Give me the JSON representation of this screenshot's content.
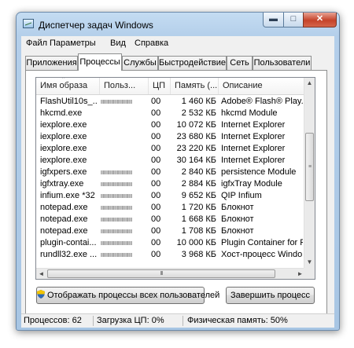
{
  "window": {
    "title": "Диспетчер задач Windows",
    "minimize_glyph": "▬",
    "maximize_glyph": "□",
    "close_glyph": "✕"
  },
  "menu": {
    "items": [
      "Файл",
      "Параметры",
      "Вид",
      "Справка"
    ]
  },
  "tabs": {
    "items": [
      "Приложения",
      "Процессы",
      "Службы",
      "Быстродействие",
      "Сеть",
      "Пользователи"
    ],
    "active": "Процессы"
  },
  "table": {
    "columns": [
      "Имя образа",
      "Польз...",
      "ЦП",
      "Память (...",
      "Описание"
    ],
    "sort_glyph": "^",
    "rows": [
      {
        "name": "FlashUtil10s_...",
        "cpu": "00",
        "mem": "1 460 КБ",
        "desc": "Adobe® Flash® Play..."
      },
      {
        "name": "hkcmd.exe",
        "cpu": "00",
        "mem": "2 532 КБ",
        "desc": "hkcmd Module"
      },
      {
        "name": "iexplore.exe",
        "cpu": "00",
        "mem": "10 072 КБ",
        "desc": "Internet Explorer"
      },
      {
        "name": "iexplore.exe",
        "cpu": "00",
        "mem": "23 680 КБ",
        "desc": "Internet Explorer"
      },
      {
        "name": "iexplore.exe",
        "cpu": "00",
        "mem": "23 220 КБ",
        "desc": "Internet Explorer"
      },
      {
        "name": "iexplore.exe",
        "cpu": "00",
        "mem": "30 164 КБ",
        "desc": "Internet Explorer"
      },
      {
        "name": "igfxpers.exe",
        "cpu": "00",
        "mem": "2 840 КБ",
        "desc": "persistence Module"
      },
      {
        "name": "igfxtray.exe",
        "cpu": "00",
        "mem": "2 884 КБ",
        "desc": "igfxTray Module"
      },
      {
        "name": "infium.exe *32",
        "cpu": "00",
        "mem": "9 652 КБ",
        "desc": "QIP Infium"
      },
      {
        "name": "notepad.exe",
        "cpu": "00",
        "mem": "1 720 КБ",
        "desc": "Блокнот"
      },
      {
        "name": "notepad.exe",
        "cpu": "00",
        "mem": "1 668 КБ",
        "desc": "Блокнот"
      },
      {
        "name": "notepad.exe",
        "cpu": "00",
        "mem": "1 708 КБ",
        "desc": "Блокнот"
      },
      {
        "name": "plugin-contai...",
        "cpu": "00",
        "mem": "10 000 КБ",
        "desc": "Plugin Container for Fi..."
      },
      {
        "name": "rundll32.exe ...",
        "cpu": "00",
        "mem": "3 968 КБ",
        "desc": "Хост-процесс Windo..."
      }
    ],
    "scroll_up_glyph": "▲",
    "scroll_down_glyph": "▼",
    "scroll_left_glyph": "◄",
    "scroll_right_glyph": "►",
    "v_grip_glyph": "≡",
    "h_grip_glyph": "III"
  },
  "buttons": {
    "show_all_label": "Отображать процессы всех пользователей",
    "end_process_label": "Завершить процесс"
  },
  "status": {
    "processes": "Процессов: 62",
    "cpu_load": "Загрузка ЦП: 0%",
    "physical_memory": "Физическая память: 50%"
  },
  "icons": {
    "app": "taskmgr-icon",
    "shield": "uac-shield-icon"
  }
}
